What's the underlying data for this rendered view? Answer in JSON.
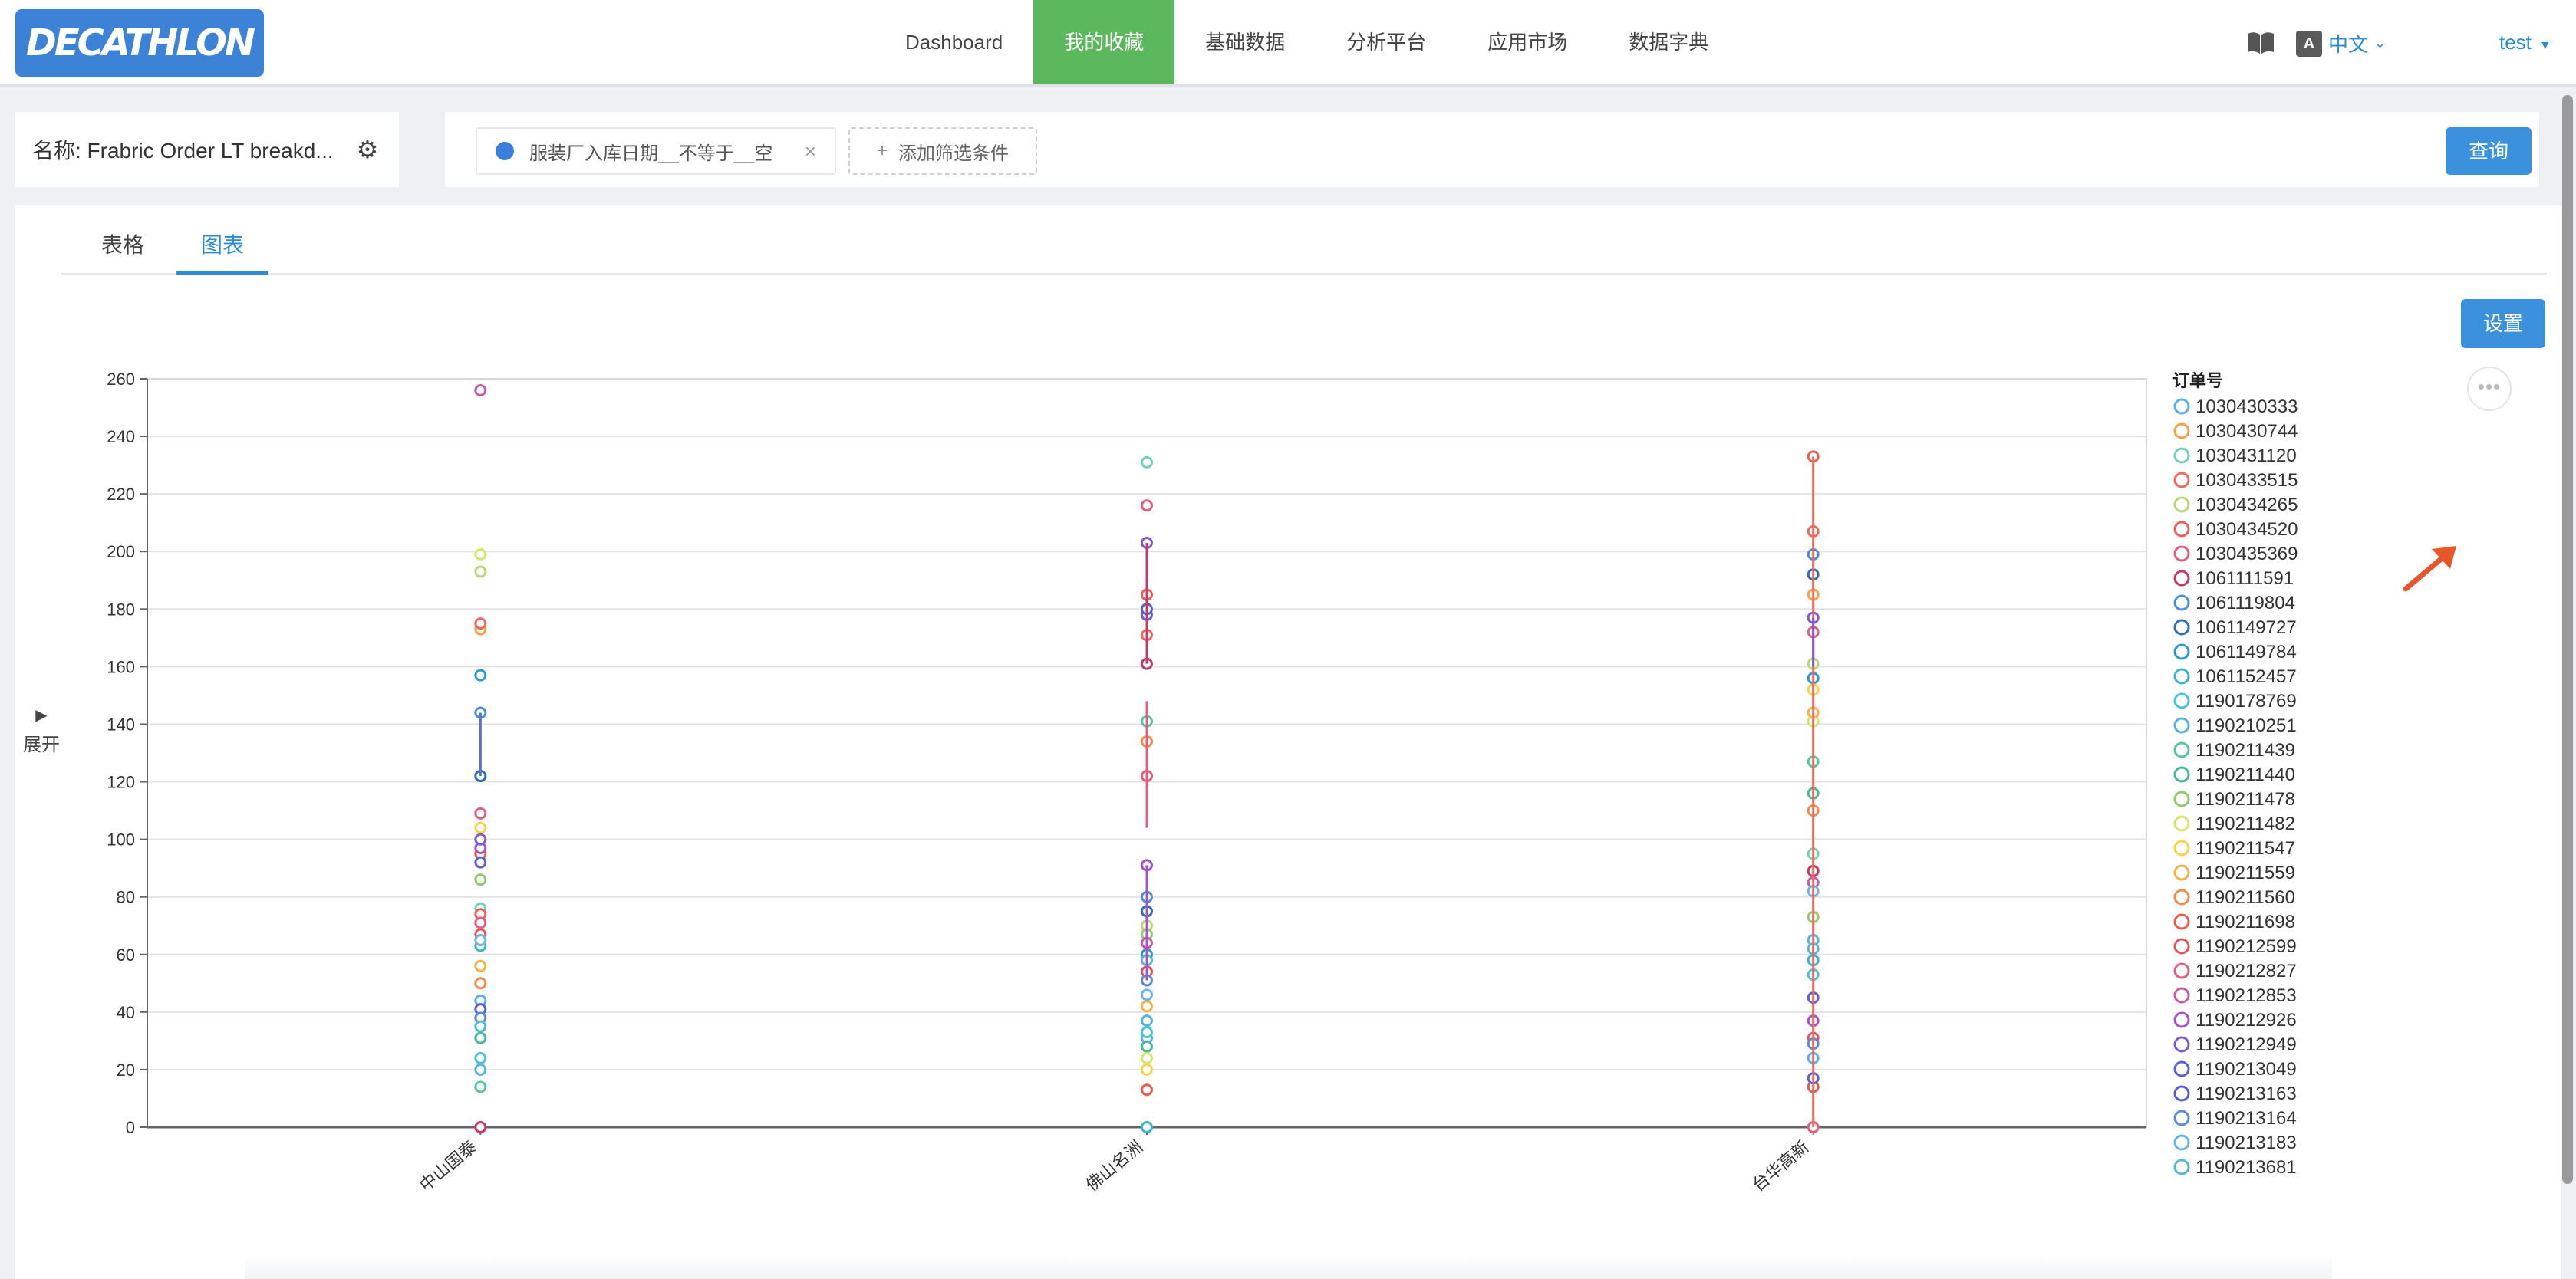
{
  "app": {
    "logo_text": "DECATHLON"
  },
  "nav": {
    "items": [
      {
        "label": "Dashboard",
        "active": false
      },
      {
        "label": "我的收藏",
        "active": true
      },
      {
        "label": "基础数据",
        "active": false
      },
      {
        "label": "分析平台",
        "active": false
      },
      {
        "label": "应用市场",
        "active": false
      },
      {
        "label": "数据字典",
        "active": false
      }
    ],
    "lang_icon_text": "A",
    "lang_label": "中文",
    "user_label": "test"
  },
  "report": {
    "name_label": "名称: Frabric Order LT breakd...",
    "filter_chip": "服装厂入库日期__不等于__空",
    "add_filter_label": "添加筛选条件",
    "query_button": "查询"
  },
  "tabs": [
    {
      "label": "表格",
      "active": false
    },
    {
      "label": "图表",
      "active": true
    }
  ],
  "settings_button": "设置",
  "expand_label": "展开",
  "colors": {
    "accent": "#3c91dc",
    "nav_active": "#5cb85c",
    "link": "#2a8bd6",
    "arrow": "#e8572c"
  },
  "chart_data": {
    "type": "scatter",
    "categories": [
      "中山国泰",
      "佛山名洲",
      "台华高新"
    ],
    "ylim": [
      0,
      260
    ],
    "y_ticks": [
      0,
      20,
      40,
      60,
      80,
      100,
      120,
      140,
      160,
      180,
      200,
      220,
      240,
      260
    ],
    "grid": true,
    "legend_position": "right",
    "legend_title": "订单号",
    "palette": [
      "#5ab1ef",
      "#f5a04a",
      "#76d0b8",
      "#ec6a5e",
      "#b6d978",
      "#e8625a",
      "#e0607e",
      "#c13b66",
      "#4a8fd8",
      "#2f6fb8",
      "#2b9ad0",
      "#3cb5c9",
      "#4cc3d9",
      "#5ab3d9",
      "#57c4a6",
      "#48b89a",
      "#8fcc6d",
      "#d4e76a",
      "#f5d44c",
      "#f6b24a",
      "#ef8e4f",
      "#ea5b4f",
      "#e6545a",
      "#e4607a",
      "#c85ba6",
      "#a454c5",
      "#7f5bd0",
      "#5b63d3",
      "#5a5fd0",
      "#5c8ad9",
      "#6ab4e8",
      "#57b8d4"
    ],
    "series": [
      {
        "name": "1030430333",
        "values": [
          [
            0,
            44
          ],
          [
            1,
            31
          ],
          [
            2,
            24
          ]
        ]
      },
      {
        "name": "1030430744",
        "values": [
          [
            0,
            173
          ],
          [
            1,
            134
          ],
          [
            2,
            185
          ]
        ]
      },
      {
        "name": "1030431120",
        "values": [
          [
            0,
            76
          ],
          [
            1,
            231
          ],
          [
            2,
            95
          ]
        ]
      },
      {
        "name": "1030433515",
        "values": [
          [
            0,
            175
          ],
          [
            1,
            171
          ],
          [
            2,
            207
          ]
        ]
      },
      {
        "name": "1030434265",
        "values": [
          [
            0,
            193
          ],
          [
            1,
            70
          ],
          [
            2,
            161
          ]
        ]
      },
      {
        "name": "1030434520",
        "values": [
          [
            0,
            74
          ],
          [
            1,
            185
          ],
          [
            2,
            233
          ]
        ]
      },
      {
        "name": "1030435369",
        "values": [
          [
            0,
            109
          ],
          [
            1,
            122
          ],
          [
            2,
            172
          ]
        ]
      },
      {
        "name": "1061111591",
        "values": [
          [
            0,
            0
          ],
          [
            1,
            161
          ],
          [
            2,
            89
          ]
        ]
      },
      {
        "name": "1061119804",
        "values": [
          [
            0,
            144
          ],
          [
            1,
            80
          ],
          [
            2,
            199
          ]
        ]
      },
      {
        "name": "1061149727",
        "values": [
          [
            0,
            122
          ],
          [
            1,
            75
          ],
          [
            2,
            192
          ]
        ]
      },
      {
        "name": "1061149784",
        "values": [
          [
            0,
            157
          ],
          [
            1,
            60
          ],
          [
            2,
            156
          ]
        ]
      },
      {
        "name": "1061152457",
        "values": [
          [
            0,
            63
          ],
          [
            1,
            0
          ],
          [
            2,
            58
          ]
        ]
      },
      {
        "name": "1190178769",
        "values": [
          [
            0,
            24
          ],
          [
            1,
            33
          ],
          [
            2,
            53
          ]
        ]
      },
      {
        "name": "1190210251",
        "values": [
          [
            0,
            20
          ],
          [
            1,
            37
          ],
          [
            2,
            65
          ]
        ]
      },
      {
        "name": "1190211439",
        "values": [
          [
            0,
            14
          ],
          [
            1,
            141
          ],
          [
            2,
            127
          ]
        ]
      },
      {
        "name": "1190211440",
        "values": [
          [
            0,
            31
          ],
          [
            1,
            28
          ],
          [
            2,
            116
          ]
        ]
      },
      {
        "name": "1190211478",
        "values": [
          [
            0,
            86
          ],
          [
            1,
            67
          ],
          [
            2,
            73
          ]
        ]
      },
      {
        "name": "1190211482",
        "values": [
          [
            0,
            199
          ],
          [
            1,
            24
          ],
          [
            2,
            141
          ]
        ]
      },
      {
        "name": "1190211547",
        "values": [
          [
            0,
            104
          ],
          [
            1,
            20
          ],
          [
            2,
            152
          ]
        ]
      },
      {
        "name": "1190211559",
        "values": [
          [
            0,
            56
          ],
          [
            1,
            42
          ],
          [
            2,
            144
          ]
        ]
      },
      {
        "name": "1190211560",
        "values": [
          [
            0,
            50
          ],
          [
            1,
            134
          ],
          [
            2,
            110
          ]
        ]
      },
      {
        "name": "1190211698",
        "values": [
          [
            0,
            95
          ],
          [
            1,
            13
          ],
          [
            2,
            14
          ]
        ]
      },
      {
        "name": "1190212599",
        "values": [
          [
            0,
            67
          ],
          [
            1,
            54
          ],
          [
            2,
            31
          ]
        ]
      },
      {
        "name": "1190212827",
        "values": [
          [
            0,
            71
          ],
          [
            1,
            216
          ],
          [
            2,
            0
          ]
        ]
      },
      {
        "name": "1190212853",
        "values": [
          [
            0,
            256
          ],
          [
            1,
            64
          ],
          [
            2,
            85
          ]
        ]
      },
      {
        "name": "1190212926",
        "values": [
          [
            0,
            97
          ],
          [
            1,
            91
          ],
          [
            2,
            37
          ]
        ]
      },
      {
        "name": "1190212949",
        "values": [
          [
            0,
            100
          ],
          [
            1,
            203
          ],
          [
            2,
            177
          ]
        ]
      },
      {
        "name": "1190213049",
        "values": [
          [
            0,
            92
          ],
          [
            1,
            178
          ],
          [
            2,
            45
          ]
        ]
      },
      {
        "name": "1190213163",
        "values": [
          [
            0,
            41
          ],
          [
            1,
            180
          ],
          [
            2,
            17
          ]
        ]
      },
      {
        "name": "1190213164",
        "values": [
          [
            0,
            38
          ],
          [
            1,
            51
          ],
          [
            2,
            29
          ]
        ]
      },
      {
        "name": "1190213183",
        "values": [
          [
            0,
            65
          ],
          [
            1,
            46
          ],
          [
            2,
            82
          ]
        ]
      },
      {
        "name": "1190213681",
        "values": [
          [
            0,
            35
          ],
          [
            1,
            58
          ],
          [
            2,
            62
          ]
        ]
      }
    ]
  }
}
